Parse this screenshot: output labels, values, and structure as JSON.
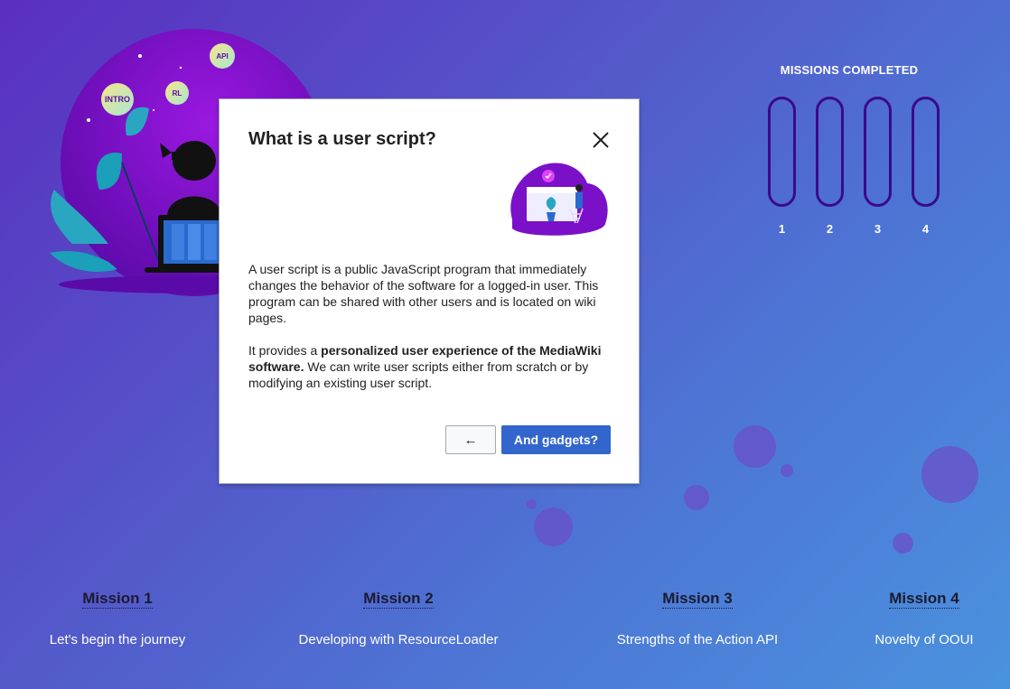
{
  "progress": {
    "title": "MISSIONS COMPLETED",
    "slots": [
      {
        "number": "1",
        "completed": false
      },
      {
        "number": "2",
        "completed": false
      },
      {
        "number": "3",
        "completed": false
      },
      {
        "number": "4",
        "completed": false
      }
    ]
  },
  "hero": {
    "badges": [
      "INTRO",
      "RL",
      "API"
    ]
  },
  "missions": [
    {
      "title": "Mission 1",
      "subtitle": "Let's begin the journey"
    },
    {
      "title": "Mission 2",
      "subtitle": "Developing with ResourceLoader"
    },
    {
      "title": "Mission 3",
      "subtitle": "Strengths of the Action API"
    },
    {
      "title": "Mission 4",
      "subtitle": "Novelty of OOUI"
    }
  ],
  "dialog": {
    "title": "What is a user script?",
    "paragraph1": "A user script is a public JavaScript program that immediately changes the behavior of the software for a logged-in user. This program can be shared with other users and is located on wiki pages.",
    "paragraph2_prefix": "It provides a ",
    "paragraph2_bold": "personalized user experience of the MediaWiki software.",
    "paragraph2_suffix": " We can write user scripts either from scratch or by modifying an existing user script.",
    "back_label": "←",
    "next_label": "And gadgets?"
  },
  "colors": {
    "accent": "#3366cc",
    "slot_border": "#3a0a8a",
    "hero_purple": "#7a10c8"
  }
}
